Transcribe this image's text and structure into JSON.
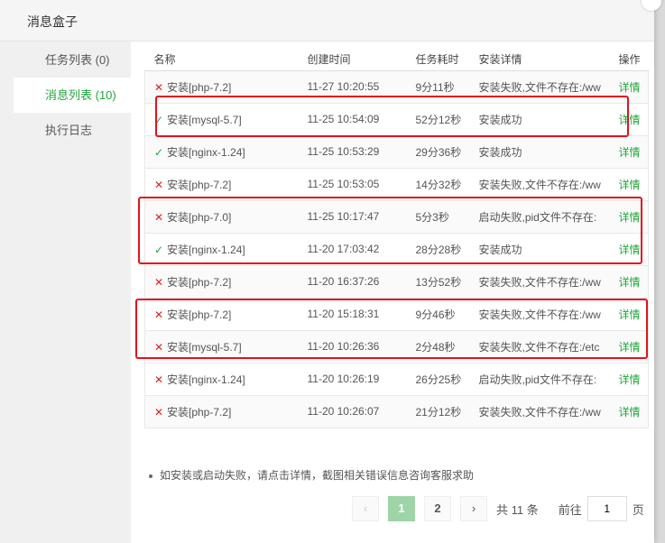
{
  "window": {
    "title": "消息盒子"
  },
  "sidebar": {
    "items": [
      {
        "label": "任务列表 (0)",
        "active": false
      },
      {
        "label": "消息列表 (10)",
        "active": true
      },
      {
        "label": "执行日志",
        "active": false
      }
    ]
  },
  "table": {
    "headers": {
      "name": "名称",
      "created": "创建时间",
      "duration": "任务耗时",
      "detail": "安装详情",
      "action": "操作"
    },
    "rows": [
      {
        "status": "fail",
        "icon": "✕",
        "name": "安装[php-7.2]",
        "created": "11-27 10:20:55",
        "duration": "9分11秒",
        "detail": "安装失败,文件不存在:/ww",
        "action": "详情"
      },
      {
        "status": "ok",
        "icon": "✓",
        "name": "安装[mysql-5.7]",
        "created": "11-25 10:54:09",
        "duration": "52分12秒",
        "detail": "安装成功",
        "action": "详情"
      },
      {
        "status": "ok",
        "icon": "✓",
        "name": "安装[nginx-1.24]",
        "created": "11-25 10:53:29",
        "duration": "29分36秒",
        "detail": "安装成功",
        "action": "详情"
      },
      {
        "status": "fail",
        "icon": "✕",
        "name": "安装[php-7.2]",
        "created": "11-25 10:53:05",
        "duration": "14分32秒",
        "detail": "安装失败,文件不存在:/ww",
        "action": "详情"
      },
      {
        "status": "fail",
        "icon": "✕",
        "name": "安装[php-7.0]",
        "created": "11-25 10:17:47",
        "duration": "5分3秒",
        "detail": "启动失败,pid文件不存在:",
        "action": "详情"
      },
      {
        "status": "ok",
        "icon": "✓",
        "name": "安装[nginx-1.24]",
        "created": "11-20 17:03:42",
        "duration": "28分28秒",
        "detail": "安装成功",
        "action": "详情"
      },
      {
        "status": "fail",
        "icon": "✕",
        "name": "安装[php-7.2]",
        "created": "11-20 16:37:26",
        "duration": "13分52秒",
        "detail": "安装失败,文件不存在:/ww",
        "action": "详情"
      },
      {
        "status": "fail",
        "icon": "✕",
        "name": "安装[php-7.2]",
        "created": "11-20 15:18:31",
        "duration": "9分46秒",
        "detail": "安装失败,文件不存在:/ww",
        "action": "详情"
      },
      {
        "status": "fail",
        "icon": "✕",
        "name": "安装[mysql-5.7]",
        "created": "11-20 10:26:36",
        "duration": "2分48秒",
        "detail": "安装失败,文件不存在:/etc",
        "action": "详情"
      },
      {
        "status": "fail",
        "icon": "✕",
        "name": "安装[nginx-1.24]",
        "created": "11-20 10:26:19",
        "duration": "26分25秒",
        "detail": "启动失败,pid文件不存在:",
        "action": "详情"
      },
      {
        "status": "fail",
        "icon": "✕",
        "name": "安装[php-7.2]",
        "created": "11-20 10:26:07",
        "duration": "21分12秒",
        "detail": "安装失败,文件不存在:/ww",
        "action": "详情"
      }
    ]
  },
  "note": "如安装或启动失败，请点击详情，截图相关错误信息咨询客服求助",
  "pagination": {
    "prev": "‹",
    "pages": [
      "1",
      "2"
    ],
    "next": "›",
    "total_text": "共 11 条",
    "goto_label": "前往",
    "goto_value": "1",
    "page_suffix": "页"
  },
  "colors": {
    "accent": "#20a53a",
    "error": "#e02020",
    "highlight": "#e0141e"
  }
}
